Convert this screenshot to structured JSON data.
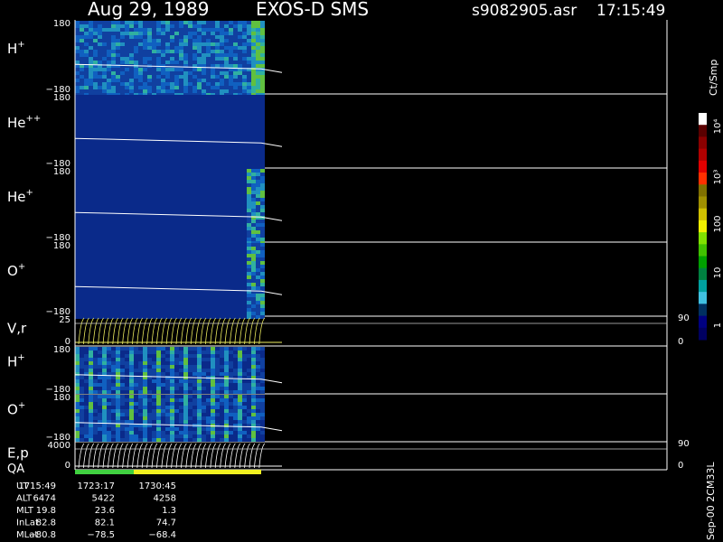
{
  "header": {
    "date": "Aug 29, 1989",
    "instrument": "EXOS-D SMS",
    "file": "s9082905.asr",
    "time": "17:15:49"
  },
  "panels": [
    {
      "ion": "H",
      "charge": "+",
      "top_tick": "180",
      "bottom_tick": "−180",
      "kind": "spectrogram",
      "variant": "h"
    },
    {
      "ion": "He",
      "charge": "++",
      "top_tick": "180",
      "bottom_tick": "−180",
      "kind": "spectrogram",
      "variant": "hepp"
    },
    {
      "ion": "He",
      "charge": "+",
      "top_tick": "180",
      "bottom_tick": "−180",
      "kind": "spectrogram",
      "variant": "hep"
    },
    {
      "ion": "O",
      "charge": "+",
      "top_tick": "180",
      "bottom_tick": "−180",
      "kind": "spectrogram",
      "variant": "op"
    },
    {
      "ion": "V,r",
      "charge": "",
      "top_tick": "25",
      "bottom_tick": "0",
      "right_top": "90",
      "right_bottom": "0",
      "kind": "lines"
    },
    {
      "ion": "H",
      "charge": "+",
      "top_tick": "180",
      "bottom_tick": "−180",
      "kind": "spectrogram",
      "variant": "h2"
    },
    {
      "ion": "O",
      "charge": "+",
      "top_tick": "180",
      "bottom_tick": "−180",
      "kind": "spectrogram",
      "variant": "o2"
    },
    {
      "ion": "E,p",
      "charge": "",
      "top_tick": "4000",
      "bottom_tick": "0",
      "right_top": "90",
      "right_bottom": "0",
      "kind": "lines2"
    }
  ],
  "qa_label": "QA",
  "colorbar": {
    "unit": "Ct/Smp",
    "labels": [
      "10⁴",
      "10³",
      "100",
      "10",
      "1"
    ],
    "colors": [
      "#ffffff",
      "#5a0000",
      "#8a0000",
      "#b00000",
      "#e00000",
      "#ff3000",
      "#807000",
      "#a09000",
      "#d0c000",
      "#f0f000",
      "#80e000",
      "#40c000",
      "#00a000",
      "#008040",
      "#00a0a0",
      "#40c0e0",
      "#003060",
      "#000080",
      "#000060"
    ]
  },
  "orbit_table": {
    "rows": [
      {
        "label": "UT",
        "values": [
          "1715:49",
          "1723:17",
          "1730:45"
        ]
      },
      {
        "label": "ALT",
        "values": [
          "6474",
          "5422",
          "4258"
        ]
      },
      {
        "label": "MLT",
        "values": [
          "19.8",
          "23.6",
          "1.3"
        ]
      },
      {
        "label": "InLat",
        "values": [
          "82.8",
          "82.1",
          "74.7"
        ]
      },
      {
        "label": "MLat",
        "values": [
          "−80.8",
          "−78.5",
          "−68.4"
        ]
      }
    ]
  },
  "footer_vertical": "Sep-00 2CM33L",
  "chart_data": {
    "type": "heatmap",
    "title": "Aug 29, 1989   EXOS-D SMS",
    "ylim": [
      -180,
      180
    ],
    "series": []
  }
}
